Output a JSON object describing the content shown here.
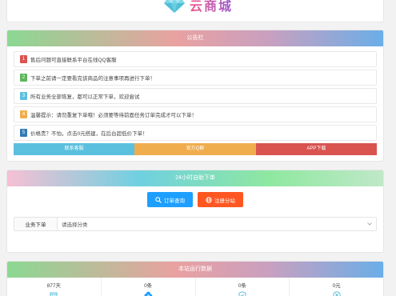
{
  "brand": {
    "name": "云商城"
  },
  "notice": {
    "title": "公告栏",
    "items": [
      {
        "num": "1",
        "text": "售后问题可直接联系平台在线QQ客服",
        "color": "#d9534f"
      },
      {
        "num": "2",
        "text": "下单之前请一定要看完该商品的注意事项再进行下单！",
        "color": "#5cb85c"
      },
      {
        "num": "3",
        "text": "所有业务全部恢复，都可以正常下单，欢迎尝试",
        "color": "#5bc0de"
      },
      {
        "num": "4",
        "text": "温馨提示：请勿重复下单哦！必须要等待前面任务订单完成才可以下单！",
        "color": "#f0ad4e"
      },
      {
        "num": "5",
        "text": "价格贵？不怕，点击0元搭建，在后台超低价下单！",
        "color": "#337ab7"
      }
    ],
    "buttons": [
      {
        "label": "联系客服",
        "color": "#5bc0de"
      },
      {
        "label": "官方Q群",
        "color": "#f0ad4e"
      },
      {
        "label": "APP下载",
        "color": "#d9534f"
      }
    ]
  },
  "order": {
    "title": "24小时自助下单",
    "query_btn": "订单查询",
    "register_btn": "注册分站",
    "category_label": "业务下单",
    "category_value": "请选择分类"
  },
  "stats": {
    "title": "本站运行数据",
    "items": [
      {
        "value": "877天",
        "icon": "calendar-icon"
      },
      {
        "value": "0条",
        "icon": "cloud-upload-icon"
      },
      {
        "value": "0条",
        "icon": "shield-check-icon"
      },
      {
        "value": "0元",
        "icon": "yen-icon"
      }
    ]
  }
}
